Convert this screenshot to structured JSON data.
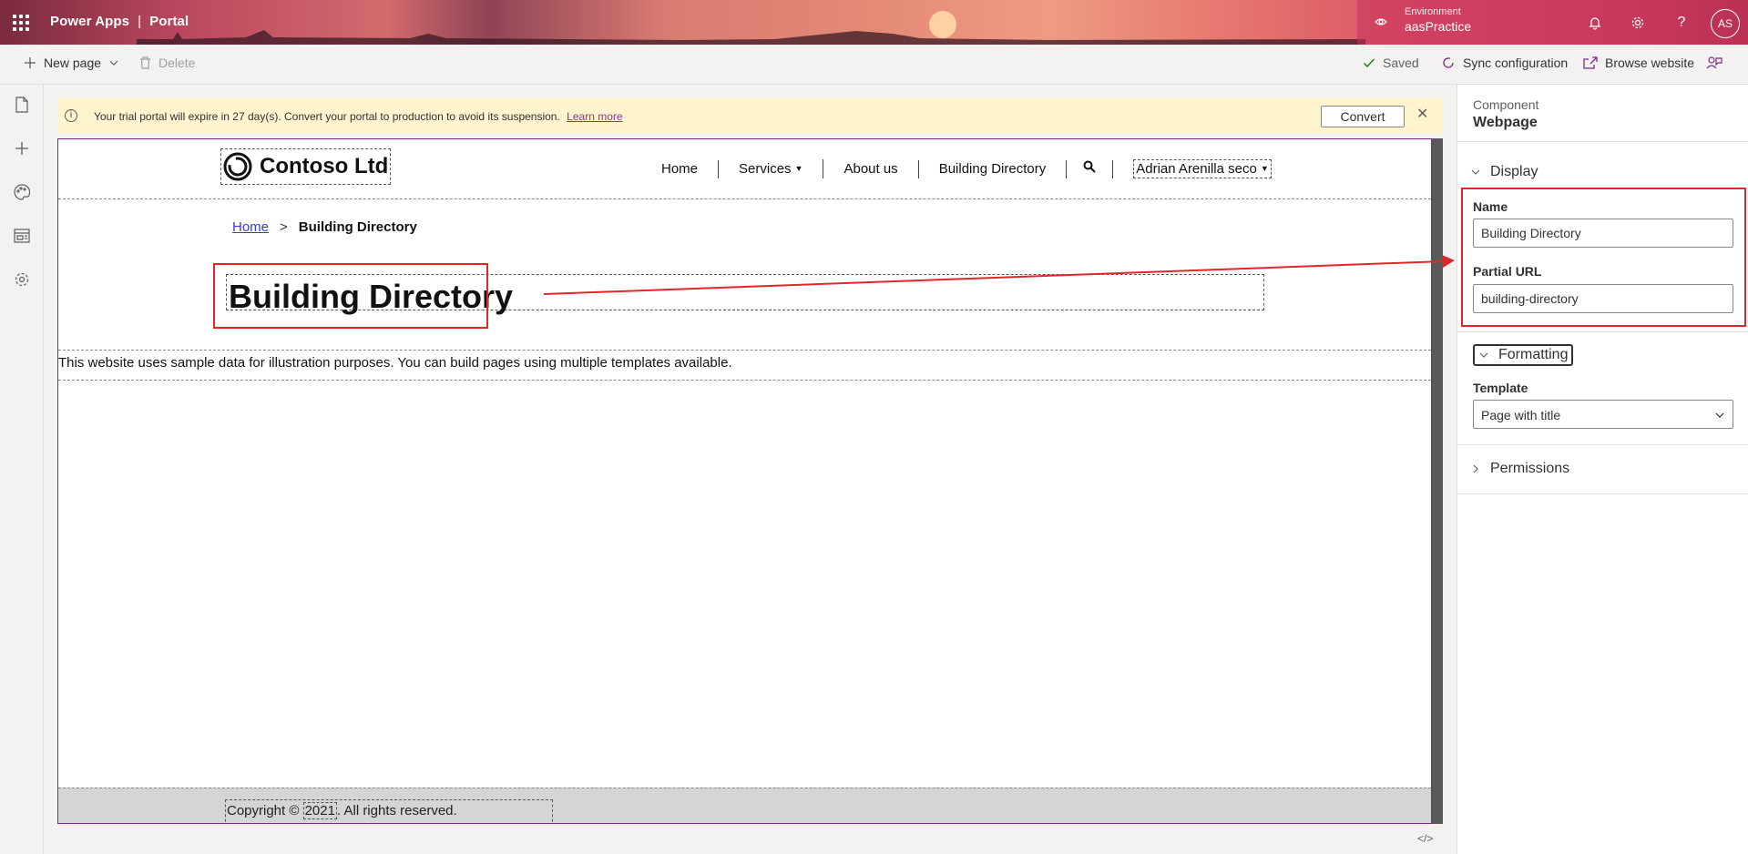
{
  "header": {
    "app_name": "Power Apps",
    "separator": "|",
    "product": "Portal",
    "environment_label": "Environment",
    "environment_name": "aasPractice",
    "avatar_initials": "AS",
    "help_glyph": "?"
  },
  "commandbar": {
    "new_page": "New page",
    "delete": "Delete",
    "saved": "Saved",
    "sync": "Sync configuration",
    "browse": "Browse website"
  },
  "trial_banner": {
    "message": "Your trial portal will expire in 27 day(s). Convert your portal to production to avoid its suspension.",
    "learn_more": "Learn more",
    "convert": "Convert"
  },
  "site": {
    "logo_text": "Contoso Ltd",
    "nav": {
      "home": "Home",
      "services": "Services",
      "about": "About us",
      "building_directory": "Building Directory",
      "user": "Adrian Arenilla seco"
    },
    "breadcrumb": {
      "home": "Home",
      "separator": ">",
      "current": "Building Directory"
    },
    "page_title": "Building Directory",
    "sample_text": "This website uses sample data for illustration purposes. You can build pages using multiple templates available.",
    "footer": {
      "prefix": "Copyright ©",
      "year": "2021",
      "suffix": ". All rights reserved."
    }
  },
  "panel": {
    "kicker": "Component",
    "title": "Webpage",
    "display_section": "Display",
    "name_label": "Name",
    "name_value": "Building Directory",
    "partial_url_label": "Partial URL",
    "partial_url_value": "building-directory",
    "formatting_section": "Formatting",
    "template_label": "Template",
    "template_value": "Page with title",
    "permissions_section": "Permissions"
  },
  "code_toggle": "</>",
  "colors": {
    "annotation_red": "#e12828",
    "site_border_purple": "#7a2a8a",
    "banner_yellow": "#fff4ce"
  }
}
